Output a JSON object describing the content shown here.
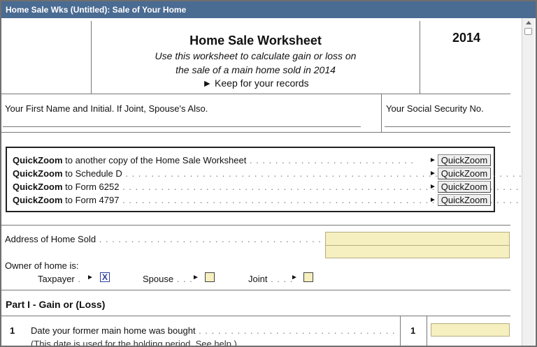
{
  "window": {
    "title": "Home Sale Wks (Untitled): Sale of Your Home"
  },
  "header": {
    "title": "Home Sale Worksheet",
    "subtitle_line1": "Use this worksheet to calculate gain or loss on",
    "subtitle_line2": "the sale of a main home sold in 2014",
    "keep": "► Keep for your records",
    "year": "2014"
  },
  "names": {
    "name_label": "Your First Name and Initial. If Joint, Spouse's Also.",
    "ssn_label": "Your Social Security No."
  },
  "quickzoom": {
    "button_label": "QuickZoom",
    "arrow": "►",
    "rows": [
      {
        "bold": "QuickZoom",
        "text": " to another copy of the Home Sale Worksheet",
        "dots": " . . . . . . . . . . . . . . . . . . . . . . . . . ."
      },
      {
        "bold": "QuickZoom",
        "text": " to Schedule D",
        "dots": " . . . . . . . . . . . . . . . . . . . . . . . . . . . . . . . . . . . . . . . . . . . . . . . . . . . . . . . . . . . . . . . . . . . . . . ."
      },
      {
        "bold": "QuickZoom",
        "text": " to Form 6252",
        "dots": " . . . . . . . . . . . . . . . . . . . . . . . . . . . . . . . . . . . . . . . . . . . . . . . . . . . . . . . . . . . . . . . . . . . . . . . ."
      },
      {
        "bold": "QuickZoom",
        "text": " to Form 4797",
        "dots": " . . . . . . . . . . . . . . . . . . . . . . . . . . . . . . . . . . . . . . . . . . . . . . . . . . . . . . . . . . . . . . . . . . . . . . . ."
      }
    ]
  },
  "address": {
    "label": "Address of Home Sold",
    "dots": " . . . . . . . . . . . . . . . . . . . . . . . . . . . . . . . . . . . . . . . . . . . . .",
    "line1": "",
    "line2": ""
  },
  "owner": {
    "label": "Owner of home is:",
    "arrow": "►",
    "taxpayer": {
      "label": "Taxpayer",
      "dots": " .",
      "checked": "X"
    },
    "spouse": {
      "label": "Spouse",
      "dots": " . . .",
      "checked": ""
    },
    "joint": {
      "label": "Joint",
      "dots": " . . . .",
      "checked": ""
    }
  },
  "part1": {
    "title": "Part I - Gain or (Loss)",
    "line1": {
      "num": "1",
      "text": "Date your former main home was bought",
      "dots": " . . . . . . . . . . . . . . . . . . . . . . . . . . . . . . . . . . . . . . . .",
      "box_num": "1",
      "note": "(This date is used for the holding period. See help.)",
      "value": ""
    }
  },
  "colors": {
    "titlebar": "#4a6b92",
    "field": "#f6efbf"
  }
}
